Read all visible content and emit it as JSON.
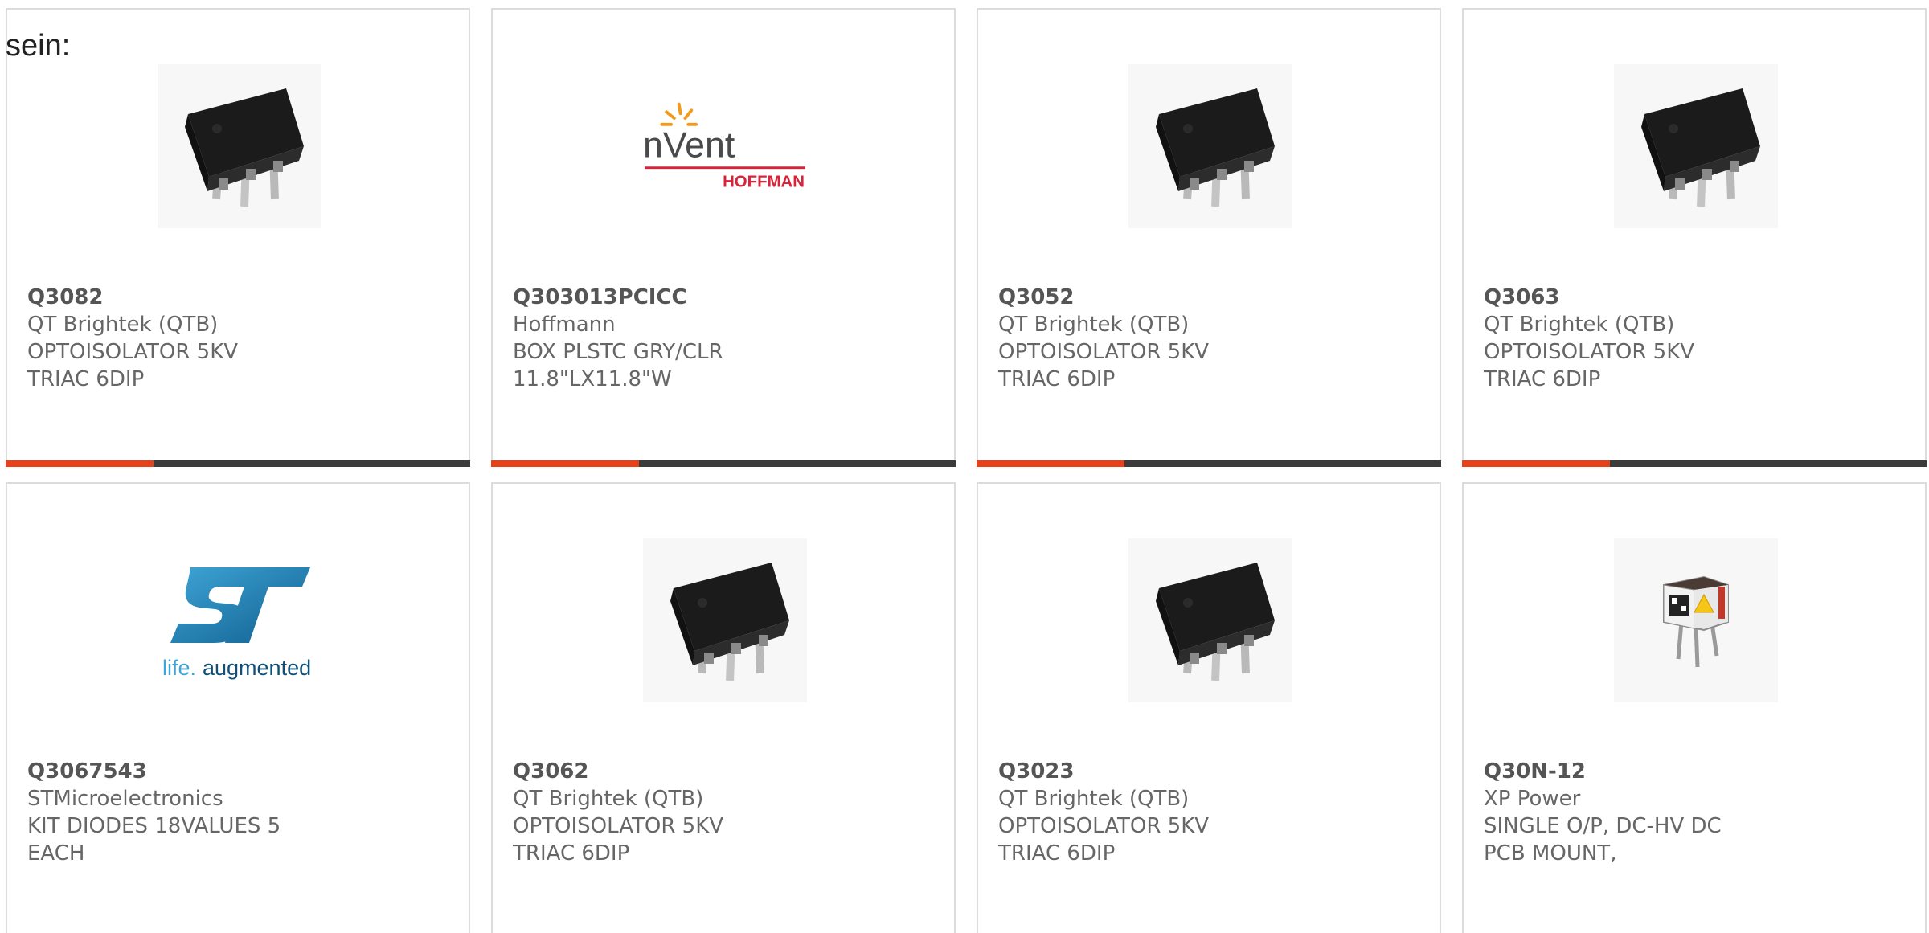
{
  "intro_text": "sein:",
  "colors": {
    "accent_orange": "#e8411a",
    "accent_dark": "#3b3b3b",
    "card_border": "#dcdcdc",
    "text_gray": "#666666"
  },
  "products": [
    {
      "part": "Q3082",
      "manufacturer": "QT Brightek (QTB)",
      "description": "OPTOISOLATOR 5KV TRIAC 6DIP",
      "image": "dip6-chip-image"
    },
    {
      "part": "Q303013PCICC",
      "manufacturer": "Hoffmann",
      "description": "BOX PLSTC GRY/CLR 11.8\"LX11.8\"W",
      "image": "nvent-hoffman-logo",
      "logo_text": {
        "brand": "nVent",
        "sub": "HOFFMAN"
      }
    },
    {
      "part": "Q3052",
      "manufacturer": "QT Brightek (QTB)",
      "description": "OPTOISOLATOR 5KV TRIAC 6DIP",
      "image": "dip6-chip-image"
    },
    {
      "part": "Q3063",
      "manufacturer": "QT Brightek (QTB)",
      "description": "OPTOISOLATOR 5KV TRIAC 6DIP",
      "image": "dip6-chip-image"
    },
    {
      "part": "Q3067543",
      "manufacturer": "STMicroelectronics",
      "description": "KIT DIODES 18VALUES 5 EACH",
      "image": "st-logo",
      "logo_text": {
        "tagline_a": "life.",
        "tagline_b": "augmented"
      }
    },
    {
      "part": "Q3062",
      "manufacturer": "QT Brightek (QTB)",
      "description": "OPTOISOLATOR 5KV TRIAC 6DIP",
      "image": "dip6-chip-image"
    },
    {
      "part": "Q3023",
      "manufacturer": "QT Brightek (QTB)",
      "description": "OPTOISOLATOR 5KV TRIAC 6DIP",
      "image": "dip6-chip-image"
    },
    {
      "part": "Q30N-12",
      "manufacturer": "XP Power",
      "description": "SINGLE O/P, DC-HV DC PCB MOUNT,",
      "image": "hv-module-image"
    }
  ]
}
